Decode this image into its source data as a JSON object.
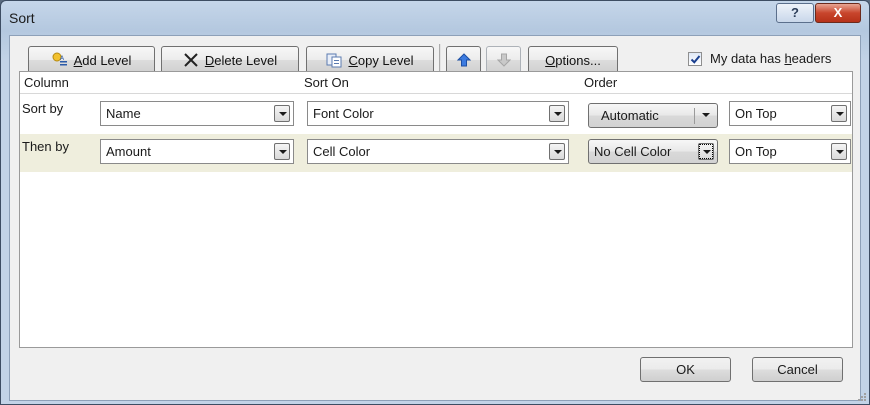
{
  "window": {
    "title": "Sort"
  },
  "titlebar": {
    "help_label": "?",
    "close_label": "X"
  },
  "toolbar": {
    "add_level": {
      "accel": "A",
      "rest": "dd Level"
    },
    "delete_level": {
      "accel": "D",
      "rest": "elete Level"
    },
    "copy_level": {
      "accel": "C",
      "rest": "opy Level"
    },
    "options": {
      "accel": "O",
      "rest": "ptions..."
    },
    "headers_checkbox": {
      "label_pre": "My data has ",
      "accel": "h",
      "label_post": "eaders",
      "checked": true
    }
  },
  "grid": {
    "headers": {
      "column": "Column",
      "sort_on": "Sort On",
      "order": "Order"
    },
    "rows": [
      {
        "label": "Sort by",
        "column": "Name",
        "sort_on": "Font Color",
        "order_color": "Automatic",
        "order_position": "On Top"
      },
      {
        "label": "Then by",
        "column": "Amount",
        "sort_on": "Cell Color",
        "order_color": "No Cell Color",
        "order_position": "On Top"
      }
    ]
  },
  "footer": {
    "ok": "OK",
    "cancel": "Cancel"
  },
  "colors": {
    "selected_row": "#efeedd",
    "close_button": "#c8452c",
    "frame": "#c5d6ea"
  }
}
